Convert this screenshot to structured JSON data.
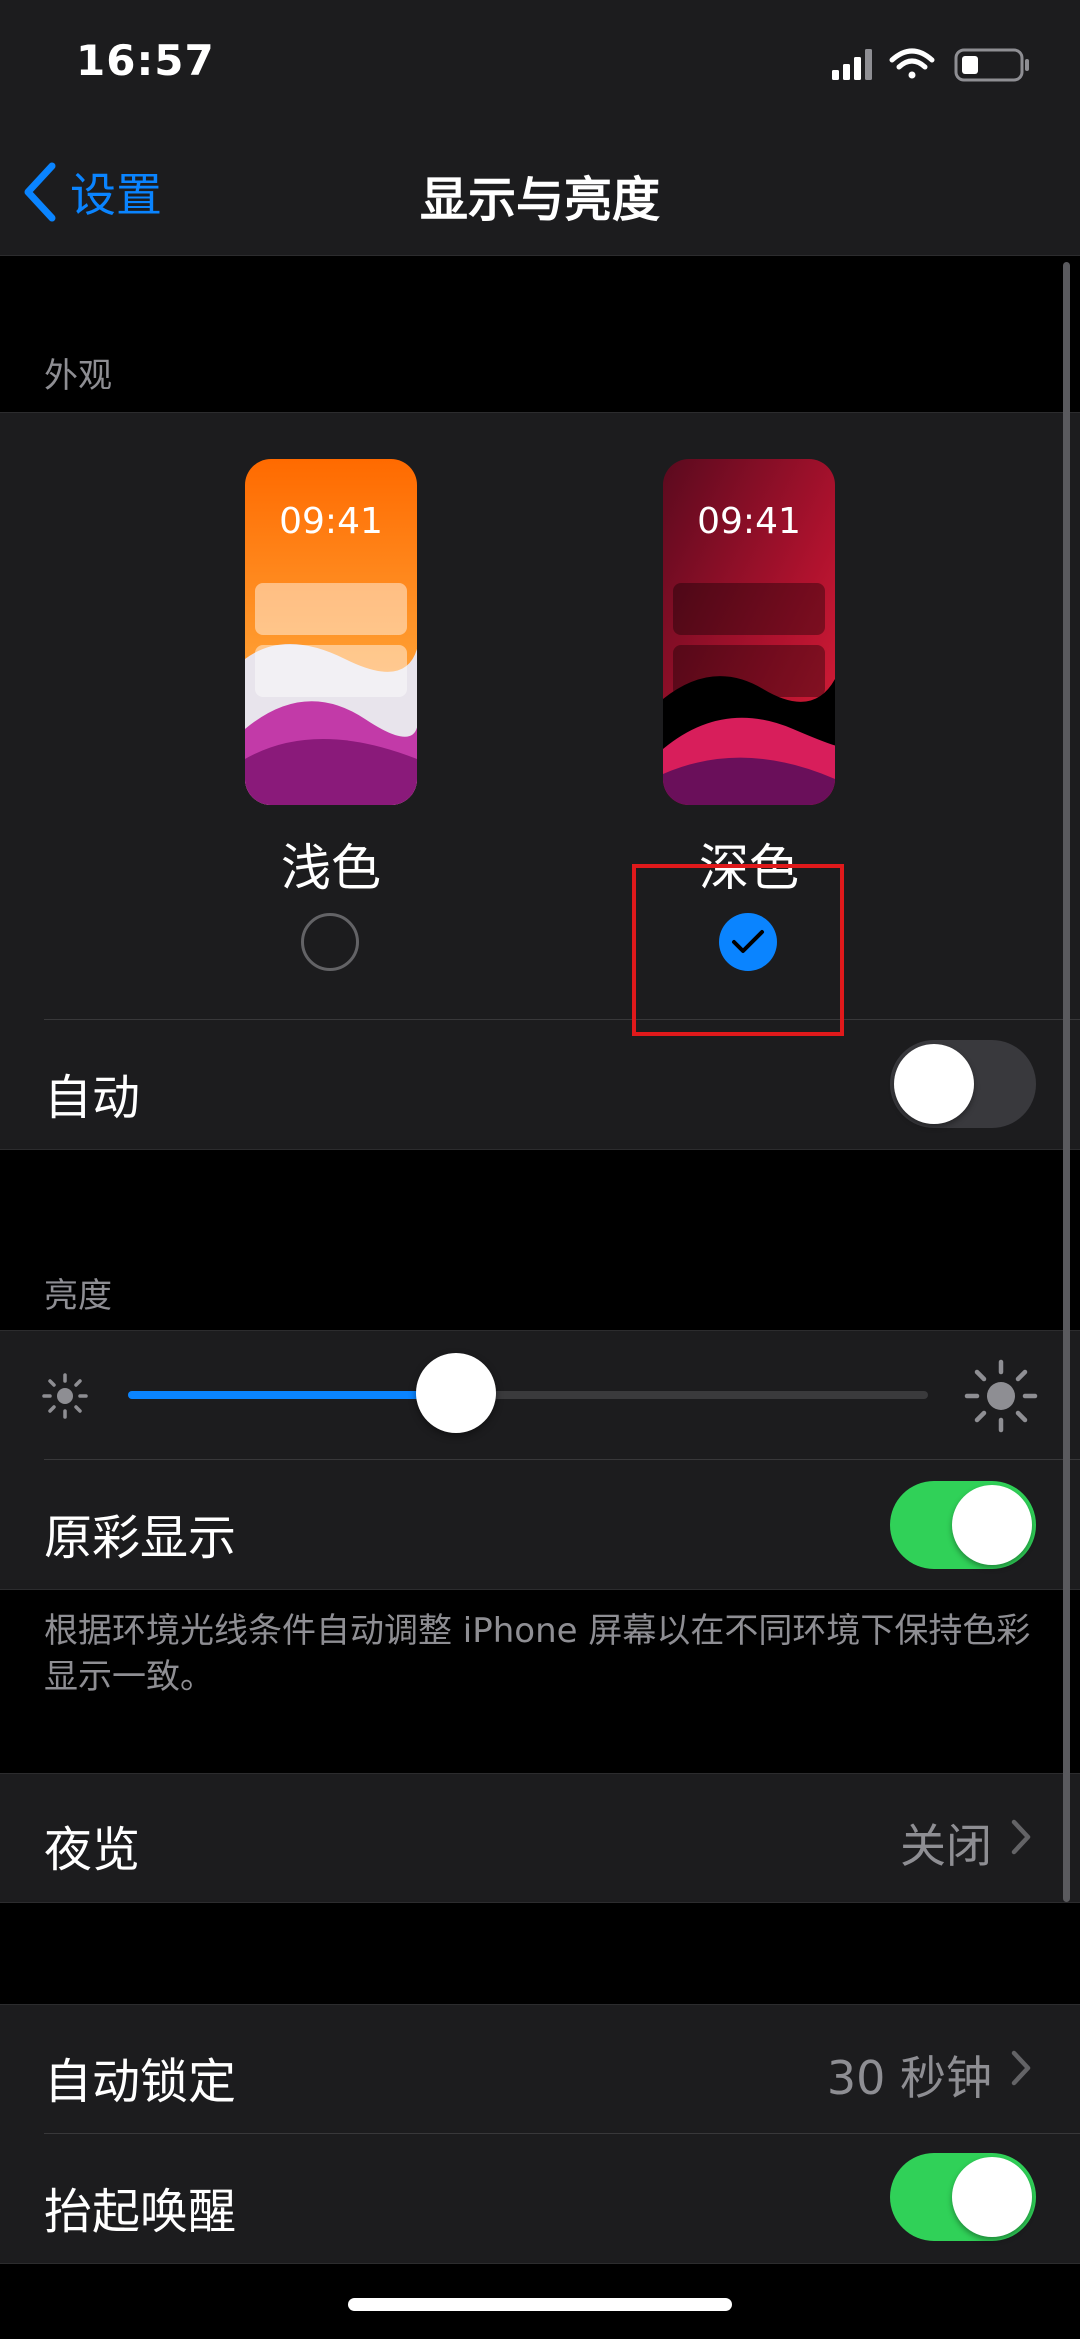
{
  "status_bar": {
    "time": "16:57"
  },
  "nav": {
    "back_label": "设置",
    "title": "显示与亮度"
  },
  "appearance": {
    "header": "外观",
    "light": {
      "preview_time": "09:41",
      "label": "浅色",
      "selected": false
    },
    "dark": {
      "preview_time": "09:41",
      "label": "深色",
      "selected": true
    },
    "auto": {
      "label": "自动",
      "on": false
    }
  },
  "brightness": {
    "header": "亮度",
    "level": 0.41,
    "true_tone": {
      "label": "原彩显示",
      "on": true
    },
    "footnote": "根据环境光线条件自动调整 iPhone 屏幕以在不同环境下保持色彩显示一致。"
  },
  "night_shift": {
    "label": "夜览",
    "value": "关闭"
  },
  "auto_lock": {
    "label": "自动锁定",
    "value": "30 秒钟"
  },
  "raise_to_wake": {
    "label": "抬起唤醒",
    "on": true
  },
  "colors": {
    "accent": "#0a84ff",
    "toggle_on": "#30d158",
    "highlight": "#e0191b"
  }
}
